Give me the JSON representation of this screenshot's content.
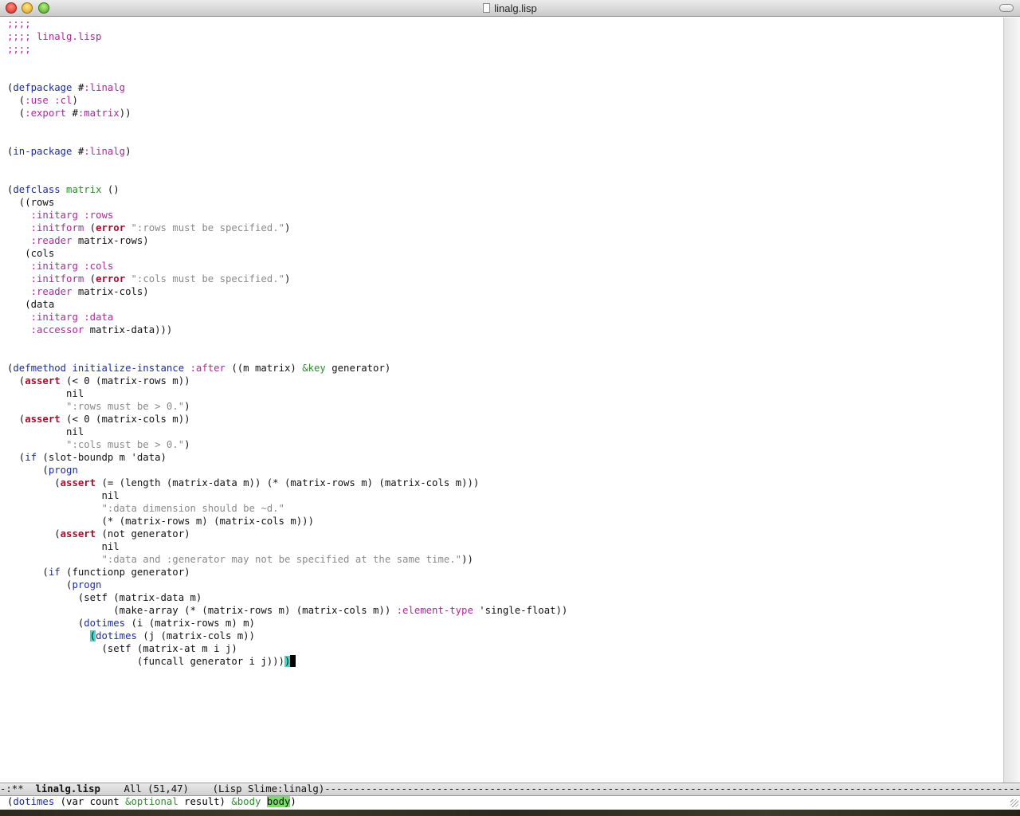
{
  "window": {
    "title": "linalg.lisp"
  },
  "editor": {
    "lines": [
      [
        {
          "t": ";;;;",
          "c": "comment"
        }
      ],
      [
        {
          "t": ";;;; linalg.lisp",
          "c": "comment"
        }
      ],
      [
        {
          "t": ";;;;",
          "c": "comment"
        }
      ],
      [],
      [],
      [
        {
          "t": "(",
          "c": "normal"
        },
        {
          "t": "defpackage",
          "c": "def"
        },
        {
          "t": " #",
          "c": "normal"
        },
        {
          "t": ":linalg",
          "c": "builtin"
        }
      ],
      [
        {
          "t": "  (",
          "c": "normal"
        },
        {
          "t": ":use",
          "c": "builtin"
        },
        {
          "t": " ",
          "c": "normal"
        },
        {
          "t": ":cl",
          "c": "builtin"
        },
        {
          "t": ")",
          "c": "normal"
        }
      ],
      [
        {
          "t": "  (",
          "c": "normal"
        },
        {
          "t": ":export",
          "c": "builtin"
        },
        {
          "t": " #",
          "c": "normal"
        },
        {
          "t": ":matrix",
          "c": "builtin"
        },
        {
          "t": "))",
          "c": "normal"
        }
      ],
      [],
      [],
      [
        {
          "t": "(",
          "c": "normal"
        },
        {
          "t": "in-package",
          "c": "def"
        },
        {
          "t": " #",
          "c": "normal"
        },
        {
          "t": ":linalg",
          "c": "builtin"
        },
        {
          "t": ")",
          "c": "normal"
        }
      ],
      [],
      [],
      [
        {
          "t": "(",
          "c": "normal"
        },
        {
          "t": "defclass",
          "c": "def"
        },
        {
          "t": " ",
          "c": "normal"
        },
        {
          "t": "matrix",
          "c": "type"
        },
        {
          "t": " ()",
          "c": "normal"
        }
      ],
      [
        {
          "t": "  ((rows",
          "c": "normal"
        }
      ],
      [
        {
          "t": "    ",
          "c": "normal"
        },
        {
          "t": ":initarg",
          "c": "builtin"
        },
        {
          "t": " ",
          "c": "normal"
        },
        {
          "t": ":rows",
          "c": "builtin"
        }
      ],
      [
        {
          "t": "    ",
          "c": "normal"
        },
        {
          "t": ":initform",
          "c": "builtin"
        },
        {
          "t": " (",
          "c": "normal"
        },
        {
          "t": "error",
          "c": "error"
        },
        {
          "t": " ",
          "c": "normal"
        },
        {
          "t": "\":rows must be specified.\"",
          "c": "string"
        },
        {
          "t": ")",
          "c": "normal"
        }
      ],
      [
        {
          "t": "    ",
          "c": "normal"
        },
        {
          "t": ":reader",
          "c": "builtin"
        },
        {
          "t": " matrix-rows)",
          "c": "normal"
        }
      ],
      [
        {
          "t": "   (cols",
          "c": "normal"
        }
      ],
      [
        {
          "t": "    ",
          "c": "normal"
        },
        {
          "t": ":initarg",
          "c": "builtin"
        },
        {
          "t": " ",
          "c": "normal"
        },
        {
          "t": ":cols",
          "c": "builtin"
        }
      ],
      [
        {
          "t": "    ",
          "c": "normal"
        },
        {
          "t": ":initform",
          "c": "builtin"
        },
        {
          "t": " (",
          "c": "normal"
        },
        {
          "t": "error",
          "c": "error"
        },
        {
          "t": " ",
          "c": "normal"
        },
        {
          "t": "\":cols must be specified.\"",
          "c": "string"
        },
        {
          "t": ")",
          "c": "normal"
        }
      ],
      [
        {
          "t": "    ",
          "c": "normal"
        },
        {
          "t": ":reader",
          "c": "builtin"
        },
        {
          "t": " matrix-cols)",
          "c": "normal"
        }
      ],
      [
        {
          "t": "   (data",
          "c": "normal"
        }
      ],
      [
        {
          "t": "    ",
          "c": "normal"
        },
        {
          "t": ":initarg",
          "c": "builtin"
        },
        {
          "t": " ",
          "c": "normal"
        },
        {
          "t": ":data",
          "c": "builtin"
        }
      ],
      [
        {
          "t": "    ",
          "c": "normal"
        },
        {
          "t": ":accessor",
          "c": "builtin"
        },
        {
          "t": " matrix-data)))",
          "c": "normal"
        }
      ],
      [],
      [],
      [
        {
          "t": "(",
          "c": "normal"
        },
        {
          "t": "defmethod",
          "c": "def"
        },
        {
          "t": " ",
          "c": "normal"
        },
        {
          "t": "initialize-instance",
          "c": "name"
        },
        {
          "t": " ",
          "c": "normal"
        },
        {
          "t": ":after",
          "c": "builtin"
        },
        {
          "t": " ((m matrix) ",
          "c": "normal"
        },
        {
          "t": "&key",
          "c": "type"
        },
        {
          "t": " generator)",
          "c": "normal"
        }
      ],
      [
        {
          "t": "  (",
          "c": "normal"
        },
        {
          "t": "assert",
          "c": "error"
        },
        {
          "t": " (< 0 (matrix-rows m))",
          "c": "normal"
        }
      ],
      [
        {
          "t": "          nil",
          "c": "normal"
        }
      ],
      [
        {
          "t": "          ",
          "c": "normal"
        },
        {
          "t": "\":rows must be > 0.\"",
          "c": "string"
        },
        {
          "t": ")",
          "c": "normal"
        }
      ],
      [
        {
          "t": "  (",
          "c": "normal"
        },
        {
          "t": "assert",
          "c": "error"
        },
        {
          "t": " (< 0 (matrix-cols m))",
          "c": "normal"
        }
      ],
      [
        {
          "t": "          nil",
          "c": "normal"
        }
      ],
      [
        {
          "t": "          ",
          "c": "normal"
        },
        {
          "t": "\":cols must be > 0.\"",
          "c": "string"
        },
        {
          "t": ")",
          "c": "normal"
        }
      ],
      [
        {
          "t": "  (",
          "c": "normal"
        },
        {
          "t": "if",
          "c": "def"
        },
        {
          "t": " (slot-boundp m 'data)",
          "c": "normal"
        }
      ],
      [
        {
          "t": "      (",
          "c": "normal"
        },
        {
          "t": "progn",
          "c": "def"
        }
      ],
      [
        {
          "t": "        (",
          "c": "normal"
        },
        {
          "t": "assert",
          "c": "error"
        },
        {
          "t": " (= (length (matrix-data m)) (* (matrix-rows m) (matrix-cols m)))",
          "c": "normal"
        }
      ],
      [
        {
          "t": "                nil",
          "c": "normal"
        }
      ],
      [
        {
          "t": "                ",
          "c": "normal"
        },
        {
          "t": "\":data dimension should be ~d.\"",
          "c": "string"
        }
      ],
      [
        {
          "t": "                (* (matrix-rows m) (matrix-cols m)))",
          "c": "normal"
        }
      ],
      [
        {
          "t": "        (",
          "c": "normal"
        },
        {
          "t": "assert",
          "c": "error"
        },
        {
          "t": " (not generator)",
          "c": "normal"
        }
      ],
      [
        {
          "t": "                nil",
          "c": "normal"
        }
      ],
      [
        {
          "t": "                ",
          "c": "normal"
        },
        {
          "t": "\":data and :generator may not be specified at the same time.\"",
          "c": "string"
        },
        {
          "t": "))",
          "c": "normal"
        }
      ],
      [
        {
          "t": "      (",
          "c": "normal"
        },
        {
          "t": "if",
          "c": "def"
        },
        {
          "t": " (functionp generator)",
          "c": "normal"
        }
      ],
      [
        {
          "t": "          (",
          "c": "normal"
        },
        {
          "t": "progn",
          "c": "def"
        }
      ],
      [
        {
          "t": "            (setf (matrix-data m)",
          "c": "normal"
        }
      ],
      [
        {
          "t": "                  (make-array (* (matrix-rows m) (matrix-cols m)) ",
          "c": "normal"
        },
        {
          "t": ":element-type",
          "c": "builtin"
        },
        {
          "t": " 'single-float))",
          "c": "normal"
        }
      ],
      [
        {
          "t": "            (",
          "c": "normal"
        },
        {
          "t": "dotimes",
          "c": "def"
        },
        {
          "t": " (i (matrix-rows m) m)",
          "c": "normal"
        }
      ],
      [
        {
          "t": "              ",
          "c": "normal"
        },
        {
          "t": "(",
          "c": "paren-hl"
        },
        {
          "t": "dotimes",
          "c": "def"
        },
        {
          "t": " (j (matrix-cols m))",
          "c": "normal"
        }
      ],
      [
        {
          "t": "                (setf (matrix-at m i j)",
          "c": "normal"
        }
      ],
      [
        {
          "t": "                      (funcall generator i j)))",
          "c": "normal"
        },
        {
          "t": ")",
          "c": "paren-hl"
        },
        {
          "t": "",
          "c": "cursor"
        }
      ]
    ]
  },
  "modeline": {
    "status": "-:**",
    "buffer_name": "linalg.lisp",
    "position": "All (51,47)",
    "mode": "(Lisp Slime:linalg)"
  },
  "minibuffer": {
    "parts": [
      {
        "t": "(",
        "c": "normal"
      },
      {
        "t": "dotimes",
        "c": "fn"
      },
      {
        "t": " (var count ",
        "c": "normal"
      },
      {
        "t": "&optional",
        "c": "kw"
      },
      {
        "t": " result) ",
        "c": "normal"
      },
      {
        "t": "&body",
        "c": "kw"
      },
      {
        "t": " ",
        "c": "normal"
      },
      {
        "t": "body",
        "c": "hl"
      },
      {
        "t": ")",
        "c": "normal"
      }
    ]
  }
}
